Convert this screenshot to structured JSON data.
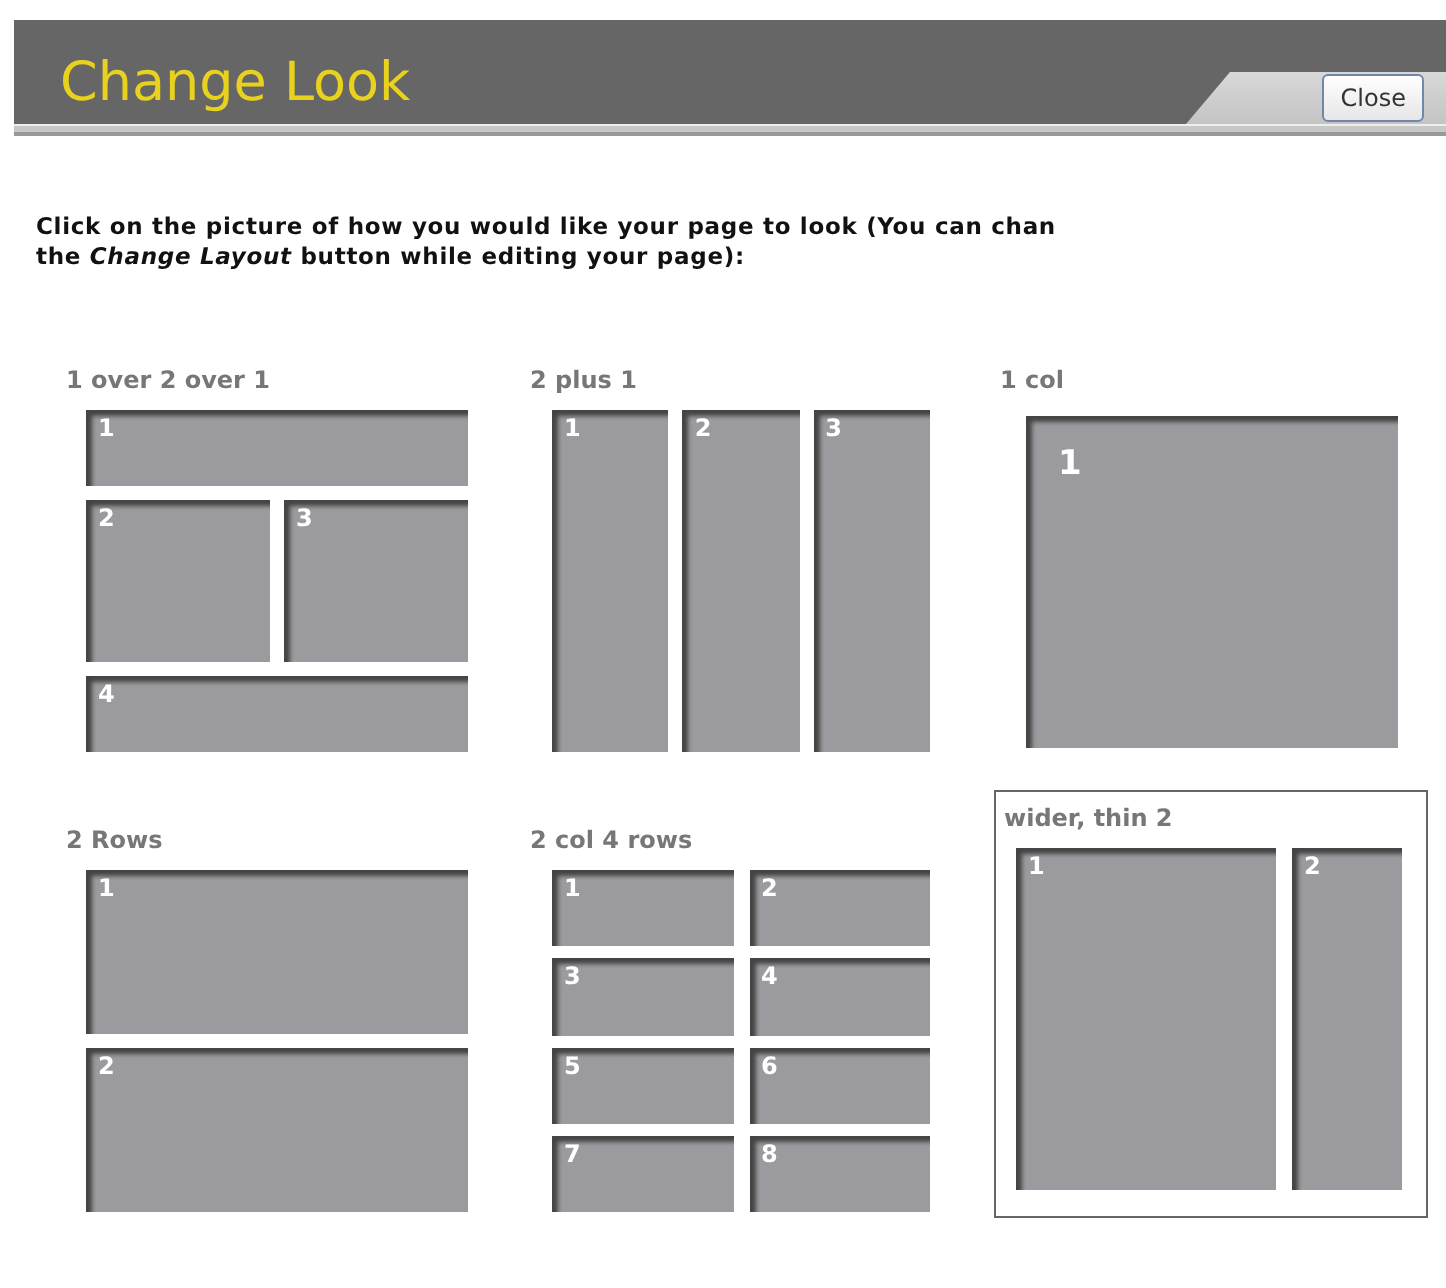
{
  "window": {
    "title": "Change Look"
  },
  "close_button": {
    "label": "Close"
  },
  "instructions": "Click on the picture of how you would like your page to look (You can chan\nthe *Change Layout* button while editing your page):",
  "layouts": [
    {
      "title": "1 over 2 over 1",
      "kind": "one-two-one",
      "selected": false,
      "panels": [
        "1",
        "2",
        "3",
        "4"
      ]
    },
    {
      "title": "2 plus 1",
      "kind": "three-cols",
      "selected": false,
      "panels": [
        "1",
        "2",
        "3"
      ]
    },
    {
      "title": "1 col",
      "kind": "single",
      "selected": false,
      "panels": [
        "1"
      ]
    },
    {
      "title": "2 Rows",
      "kind": "two-rows",
      "selected": false,
      "panels": [
        "1",
        "2"
      ]
    },
    {
      "title": "2 col 4 rows",
      "kind": "two-by-four",
      "selected": false,
      "panels": [
        "1",
        "2",
        "3",
        "4",
        "5",
        "6",
        "7",
        "8"
      ]
    },
    {
      "title": "wider, thin 2",
      "kind": "wide-thin",
      "selected": true,
      "panels": [
        "1",
        "2"
      ]
    }
  ]
}
